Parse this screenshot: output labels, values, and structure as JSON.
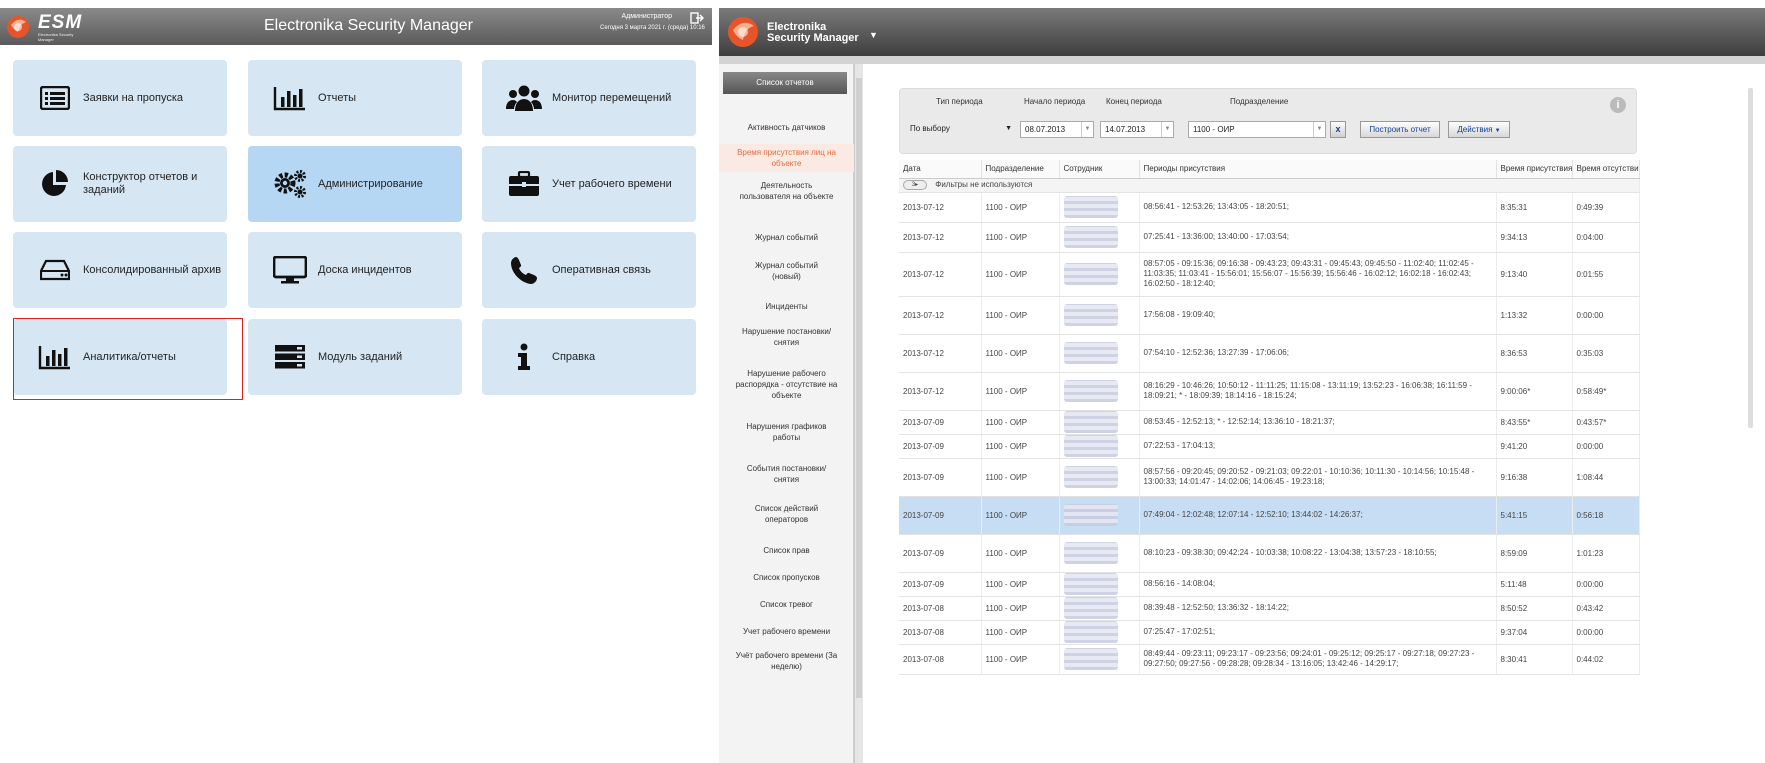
{
  "left_app": {
    "logo_text": "ESM",
    "logo_sub": "Electronika Security Manager",
    "title": "Electronika Security Manager",
    "user": "Администратор",
    "date": "Сегодня 3 марта 2021 г. (среда) 10:16",
    "tiles": [
      {
        "label": "Заявки на пропуска",
        "icon": "list-icon"
      },
      {
        "label": "Отчеты",
        "icon": "bar-chart-icon"
      },
      {
        "label": "Монитор перемещений",
        "icon": "users-icon"
      },
      {
        "label": "Конструктор отчетов и заданий",
        "icon": "pie-chart-icon"
      },
      {
        "label": "Администрирование",
        "icon": "gears-icon"
      },
      {
        "label": "Учет рабочего времени",
        "icon": "briefcase-icon"
      },
      {
        "label": "Консолидированный архив",
        "icon": "hdd-icon"
      },
      {
        "label": "Доска инцидентов",
        "icon": "monitor-icon"
      },
      {
        "label": "Оперативная связь",
        "icon": "phone-icon"
      },
      {
        "label": "Аналитика/отчеты",
        "icon": "bar-chart-icon"
      },
      {
        "label": "Модуль заданий",
        "icon": "server-icon"
      },
      {
        "label": "Справка",
        "icon": "info-icon"
      }
    ]
  },
  "right_app": {
    "brand_line1": "Electronika",
    "brand_line2": "Security Manager",
    "sidebar_title": "Список отчетов",
    "sidebar_items": [
      "Активность датчиков",
      "Время присутствия лиц на объекте",
      "Деятельность пользователя на объекте",
      "Журнал событий",
      "Журнал событий (новый)",
      "Инциденты",
      "Нарушение постановки/снятия",
      "Нарушение рабочего распорядка - отсутствие на объекте",
      "Нарушения графиков работы",
      "События постановки/снятия",
      "Список действий операторов",
      "Список прав",
      "Список пропусков",
      "Список тревог",
      "Учет рабочего времени",
      "Учёт рабочего времени (За неделю)"
    ],
    "filter": {
      "period_type_label": "Тип периода",
      "period_type_value": "По выбору",
      "start_label": "Начало периода",
      "start_value": "08.07.2013",
      "end_label": "Конец периода",
      "end_value": "14.07.2013",
      "dept_label": "Подразделение",
      "dept_value": "1100 - ОИР",
      "clear": "x",
      "build_btn": "Построить отчет",
      "actions_btn": "Действия"
    },
    "columns": [
      "Дата",
      "Подразделение",
      "Сотрудник",
      "Периоды присутствия",
      "Время присутствия",
      "Время отсутствия"
    ],
    "filter_note": "Фильтры не используются",
    "rows": [
      {
        "date": "2013-07-12",
        "dept": "1100 - ОИР",
        "periods": "08:56:41 - 12:53:26; 13:43:05 - 18:20:51;",
        "present": "8:35:31",
        "absent": "0:49:39"
      },
      {
        "date": "2013-07-12",
        "dept": "1100 - ОИР",
        "periods": "07:25:41 - 13:36:00; 13:40:00 - 17:03:54;",
        "present": "9:34:13",
        "absent": "0:04:00"
      },
      {
        "date": "2013-07-12",
        "dept": "1100 - ОИР",
        "periods": "08:57:05 - 09:15:36; 09:16:38 - 09:43:23; 09:43:31 - 09:45:43; 09:45:50 - 11:02:40; 11:02:45 - 11:03:35; 11:03:41 - 15:56:01; 15:56:07 - 15:56:39; 15:56:46 - 16:02:12; 16:02:18 - 16:02:43; 16:02:50 - 18:12:40;",
        "present": "9:13:40",
        "absent": "0:01:55"
      },
      {
        "date": "2013-07-12",
        "dept": "1100 - ОИР",
        "periods": "17:56:08 - 19:09:40;",
        "present": "1:13:32",
        "absent": "0:00:00"
      },
      {
        "date": "2013-07-12",
        "dept": "1100 - ОИР",
        "periods": "07:54:10 - 12:52:36; 13:27:39 - 17:06:06;",
        "present": "8:36:53",
        "absent": "0:35:03"
      },
      {
        "date": "2013-07-12",
        "dept": "1100 - ОИР",
        "periods": "08:16:29 - 10:46:26; 10:50:12 - 11:11:25; 11:15:08 - 13:11:19; 13:52:23 - 16:06:38; 16:11:59 - 18:09:21; * - 18:09:39; 18:14:16 - 18:15:24;",
        "present": "9:00:06*",
        "absent": "0:58:49*"
      },
      {
        "date": "2013-07-09",
        "dept": "1100 - ОИР",
        "periods": "08:53:45 - 12:52:13; * - 12:52:14; 13:36:10 - 18:21:37;",
        "present": "8:43:55*",
        "absent": "0:43:57*"
      },
      {
        "date": "2013-07-09",
        "dept": "1100 - ОИР",
        "periods": "07:22:53 - 17:04:13;",
        "present": "9:41:20",
        "absent": "0:00:00"
      },
      {
        "date": "2013-07-09",
        "dept": "1100 - ОИР",
        "periods": "08:57:56 - 09:20:45; 09:20:52 - 09:21:03; 09:22:01 - 10:10:36; 10:11:30 - 10:14:56; 10:15:48 - 13:00:33; 14:01:47 - 14:02:06; 14:06:45 - 19:23:18;",
        "present": "9:16:38",
        "absent": "1:08:44"
      },
      {
        "date": "2013-07-09",
        "dept": "1100 - ОИР",
        "periods": "07:49:04 - 12:02:48; 12:07:14 - 12:52:10; 13:44:02 - 14:26:37;",
        "present": "5:41:15",
        "absent": "0:56:18"
      },
      {
        "date": "2013-07-09",
        "dept": "1100 - ОИР",
        "periods": "08:10:23 - 09:38:30; 09:42:24 - 10:03:38; 10:08:22 - 13:04:38; 13:57:23 - 18:10:55;",
        "present": "8:59:09",
        "absent": "1:01:23"
      },
      {
        "date": "2013-07-09",
        "dept": "1100 - ОИР",
        "periods": "08:56:16 - 14:08:04;",
        "present": "5:11:48",
        "absent": "0:00:00"
      },
      {
        "date": "2013-07-08",
        "dept": "1100 - ОИР",
        "periods": "08:39:48 - 12:52:50; 13:36:32 - 18:14:22;",
        "present": "8:50:52",
        "absent": "0:43:42"
      },
      {
        "date": "2013-07-08",
        "dept": "1100 - ОИР",
        "periods": "07:25:47 - 17:02:51;",
        "present": "9:37:04",
        "absent": "0:00:00"
      },
      {
        "date": "2013-07-08",
        "dept": "1100 - ОИР",
        "periods": "08:49:44 - 09:23:11; 09:23:17 - 09:23:56; 09:24:01 - 09:25:12; 09:25:17 - 09:27:18; 09:27:23 - 09:27:50; 09:27:56 - 09:28:28; 09:28:34 - 13:16:05; 13:42:46 - 14:29:17;",
        "present": "8:30:41",
        "absent": "0:44:02"
      }
    ]
  }
}
